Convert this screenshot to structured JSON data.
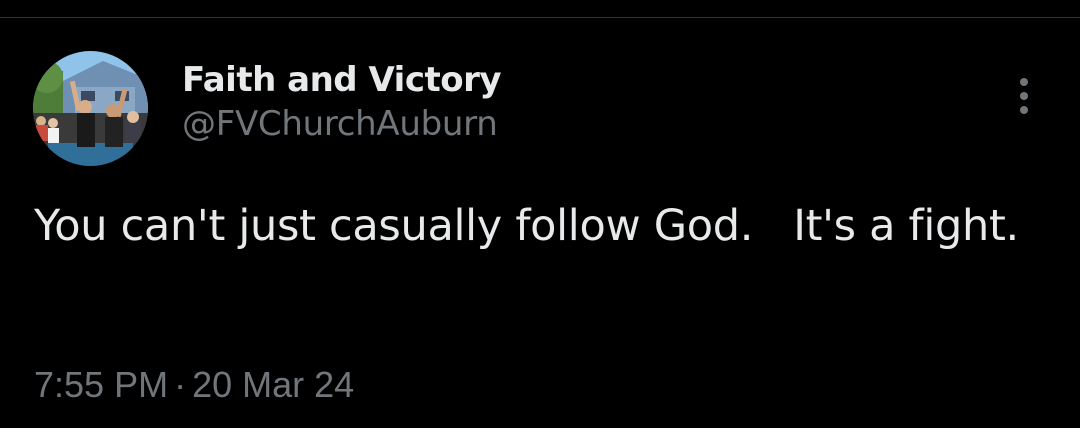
{
  "tweet": {
    "author": {
      "display_name": "Faith and Victory",
      "handle": "@FVChurchAuburn",
      "avatar_icon": "profile-photo-avatar"
    },
    "more_icon": "more-vertical-icon",
    "text": "You can't just casually follow God.   It's a fight.",
    "time": "7:55 PM",
    "separator": "·",
    "date": "20 Mar 24"
  },
  "colors": {
    "background": "#000000",
    "primary_text": "#e7e9ea",
    "secondary_text": "#71767b",
    "divider": "#2f3336"
  }
}
